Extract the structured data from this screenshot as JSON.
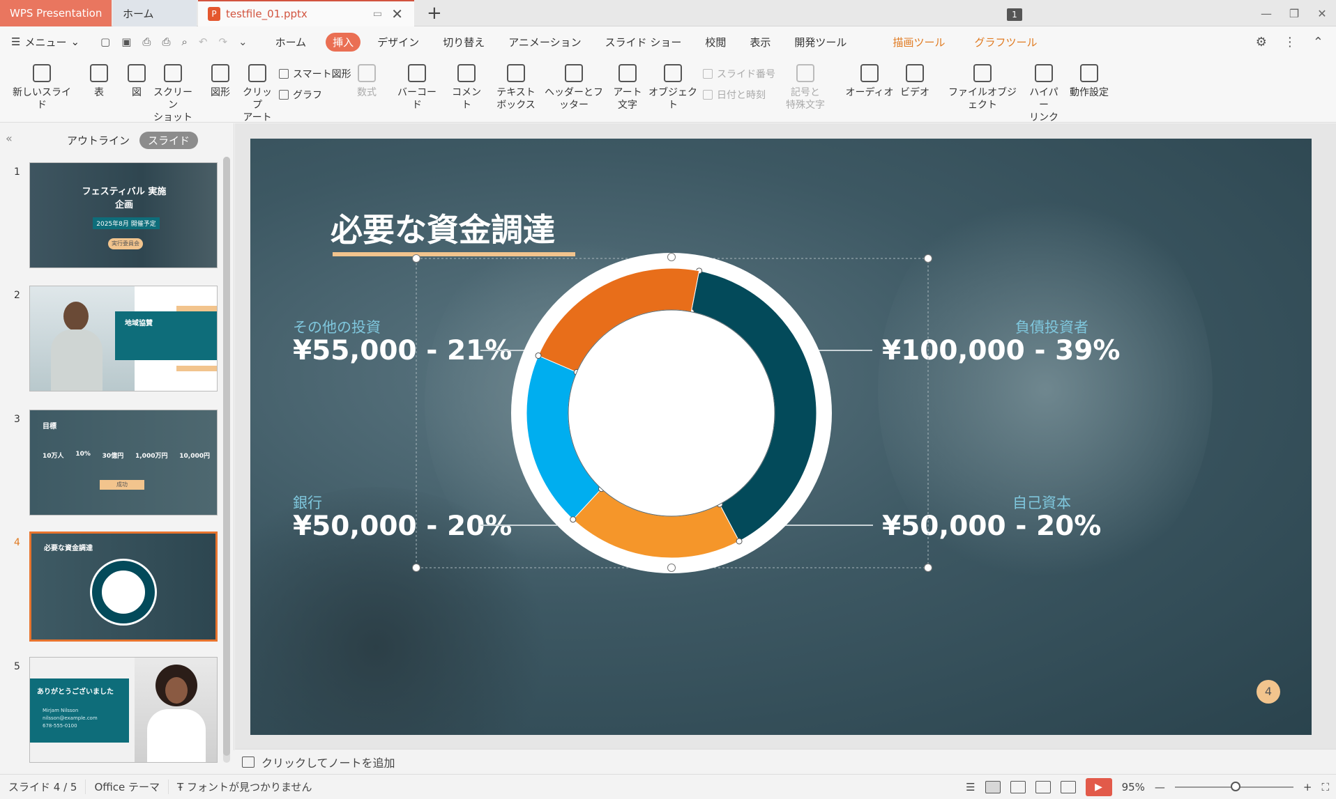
{
  "titlebar": {
    "app_tab": "WPS Presentation",
    "home_tab": "ホーム",
    "file_tab": "testfile_01.pptx",
    "badge": "1"
  },
  "menubar": {
    "menu_label": "メニュー",
    "tabs": [
      "ホーム",
      "挿入",
      "デザイン",
      "切り替え",
      "アニメーション",
      "スライド ショー",
      "校閲",
      "表示",
      "開発ツール",
      "描画ツール",
      "グラフツール"
    ],
    "active_tab": "挿入"
  },
  "ribbon": {
    "new_slide": "新しいスライド",
    "table": "表",
    "picture": "図",
    "screenshot_1": "スクリーン",
    "screenshot_2": "ショット",
    "shapes": "図形",
    "clipart_1": "クリップ",
    "clipart_2": "アート",
    "smartart": "スマート図形",
    "chart": "グラフ",
    "equation": "数式",
    "barcode": "バーコード",
    "comment": "コメント",
    "textbox_1": "テキスト",
    "textbox_2": "ボックス",
    "header_footer": "ヘッダーとフッター",
    "wordart_1": "アート",
    "wordart_2": "文字",
    "object": "オブジェクト",
    "slide_number": "スライド番号",
    "date_time": "日付と時刻",
    "symbol_1": "記号と",
    "symbol_2": "特殊文字",
    "audio": "オーディオ",
    "video": "ビデオ",
    "file_object": "ファイルオブジェクト",
    "hyperlink_1": "ハイパー",
    "hyperlink_2": "リンク",
    "action": "動作設定"
  },
  "panel": {
    "outline_tab": "アウトライン",
    "slide_tab": "スライド",
    "thumbnails": [
      {
        "num": "1",
        "title": "フェスティバル 実施企画",
        "sub": "2025年8月 開催予定",
        "chip": "実行委員会"
      },
      {
        "num": "2",
        "title": "地域協賛"
      },
      {
        "num": "3",
        "title": "目標",
        "stats": [
          "10万人",
          "10%",
          "30億円",
          "1,000万円",
          "10,000円"
        ],
        "chip": "成功"
      },
      {
        "num": "4",
        "title": "必要な資金調達"
      },
      {
        "num": "5",
        "title": "ありがとうございました",
        "lines": [
          "Mirjam Nilsson",
          "nilsson@example.com",
          "678-555-0100"
        ]
      }
    ]
  },
  "slide": {
    "title": "必要な資金調達",
    "page_number": "4",
    "colors": {
      "debt": "#034a5a",
      "equity": "#f5962a",
      "bank": "#00aeef",
      "other": "#e86e1a"
    }
  },
  "chart_data": {
    "type": "pie",
    "donut": true,
    "categories": [
      "負債投資者",
      "自己資本",
      "銀行",
      "その他の投資"
    ],
    "values": [
      100000,
      50000,
      50000,
      55000
    ],
    "percent_labels": [
      "39%",
      "20%",
      "20%",
      "21%"
    ],
    "labels": [
      "¥100,000 - 39%",
      "¥50,000 - 20%",
      "¥50,000 - 20%",
      "¥55,000 - 21%"
    ],
    "title": ""
  },
  "notes": {
    "placeholder": "クリックしてノートを追加"
  },
  "status": {
    "slide_count": "スライド 4 / 5",
    "theme": "Office テーマ",
    "font_warning": "フォントが見つかりません",
    "zoom": "95%"
  }
}
